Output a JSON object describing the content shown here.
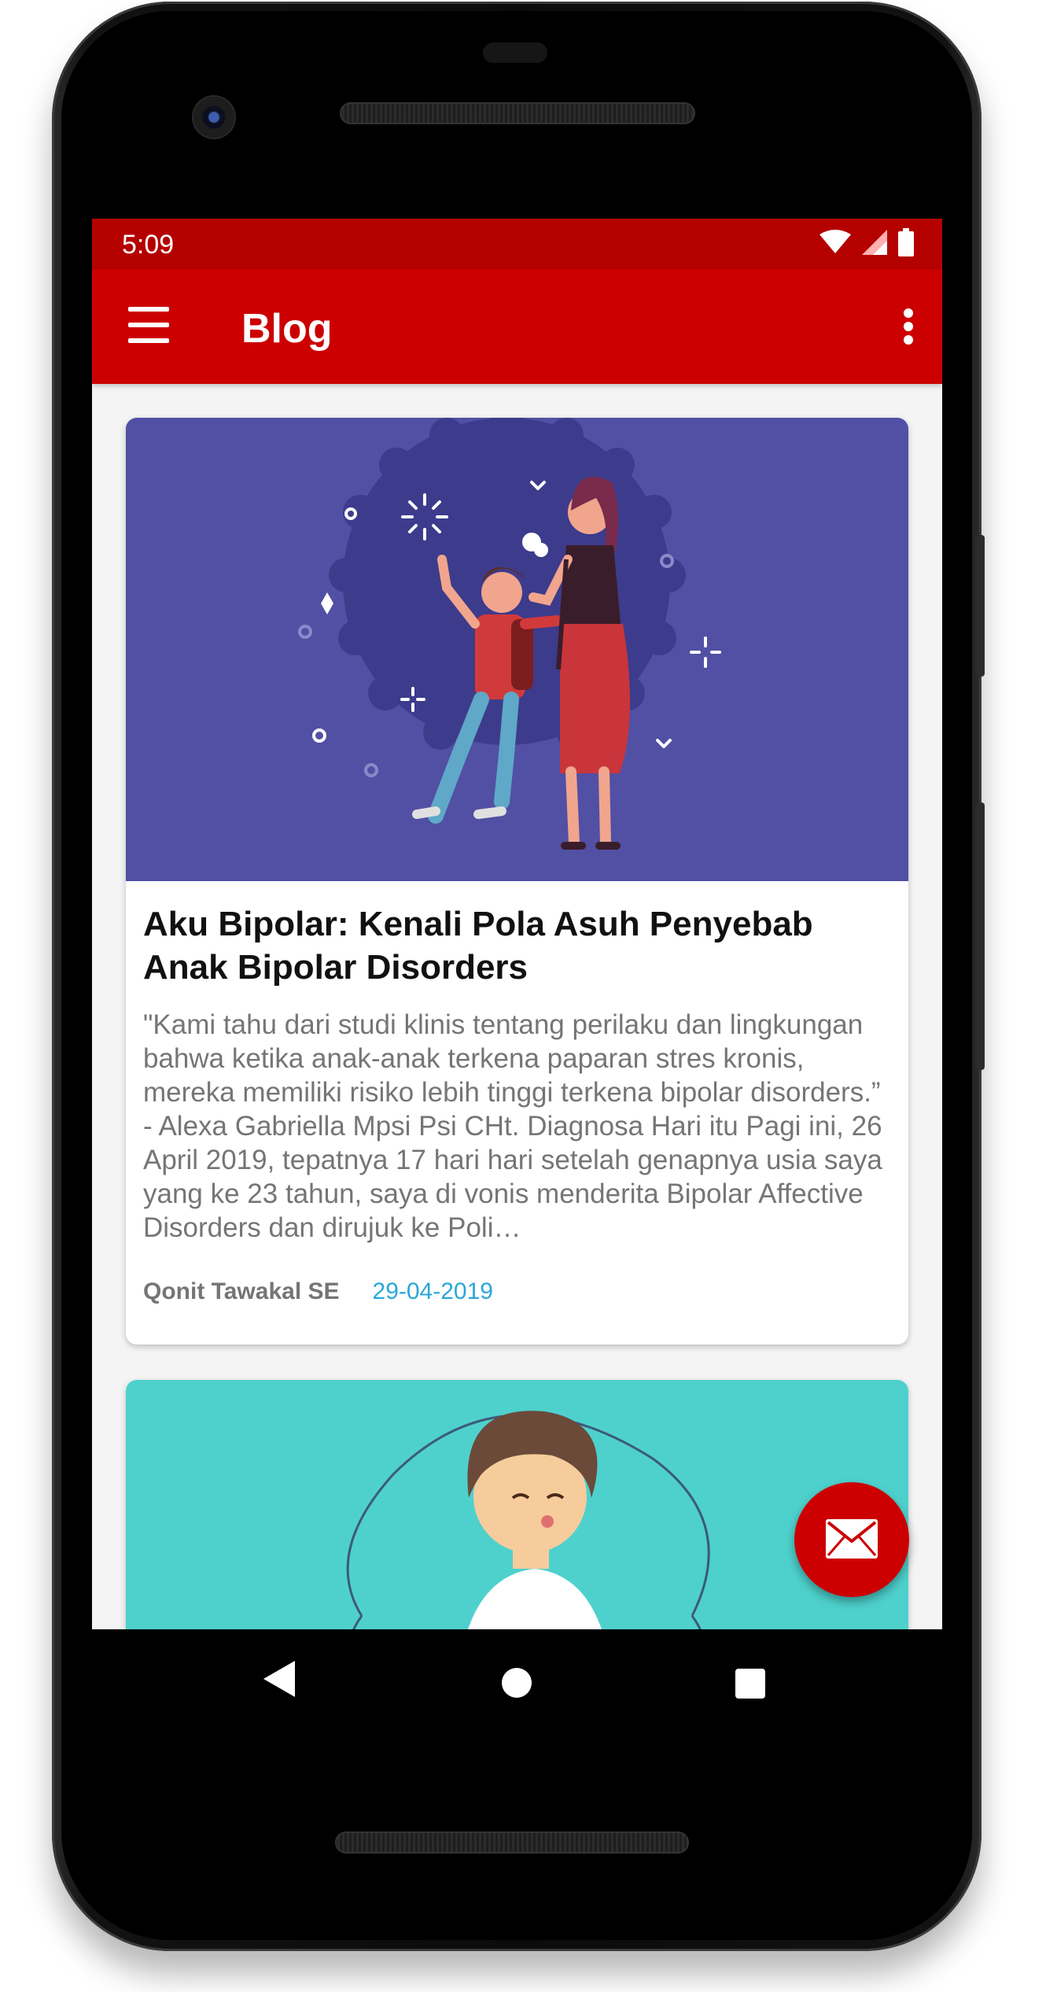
{
  "status_bar": {
    "time": "5:09",
    "icons": [
      "wifi-icon",
      "signal-icon",
      "battery-icon"
    ]
  },
  "app_bar": {
    "title": "Blog",
    "menu_icon": "hamburger-menu-icon",
    "overflow_icon": "more-vert-icon"
  },
  "posts": [
    {
      "image": "illustration-mother-scolding-child",
      "title": "Aku Bipolar: Kenali Pola Asuh Penyebab Anak Bipolar Disorders",
      "excerpt": "\"Kami tahu dari studi klinis tentang perilaku dan lingkungan bahwa ketika anak-anak terkena paparan stres kronis, mereka memiliki risiko lebih tinggi terkena bipolar disorders.” - Alexa Gabriella Mpsi Psi CHt. Diagnosa Hari itu Pagi ini, 26 April 2019, tepatnya 17 hari hari setelah genapnya usia saya yang ke 23 tahun, saya di vonis menderita Bipolar Affective Disorders dan dirujuk ke Poli…",
      "author": "Qonit Tawakal SE",
      "date": "29-04-2019"
    },
    {
      "image": "illustration-boy-meditating"
    }
  ],
  "fab": {
    "icon": "mail-icon"
  },
  "nav_bar": {
    "icons": [
      "back-icon",
      "home-icon",
      "recents-icon"
    ]
  },
  "colors": {
    "status_bar": "#b50000",
    "app_bar": "#cc0000",
    "card_image_1": "#5150a4",
    "card_image_2": "#4ed1cd",
    "date": "#2aa7d8"
  }
}
